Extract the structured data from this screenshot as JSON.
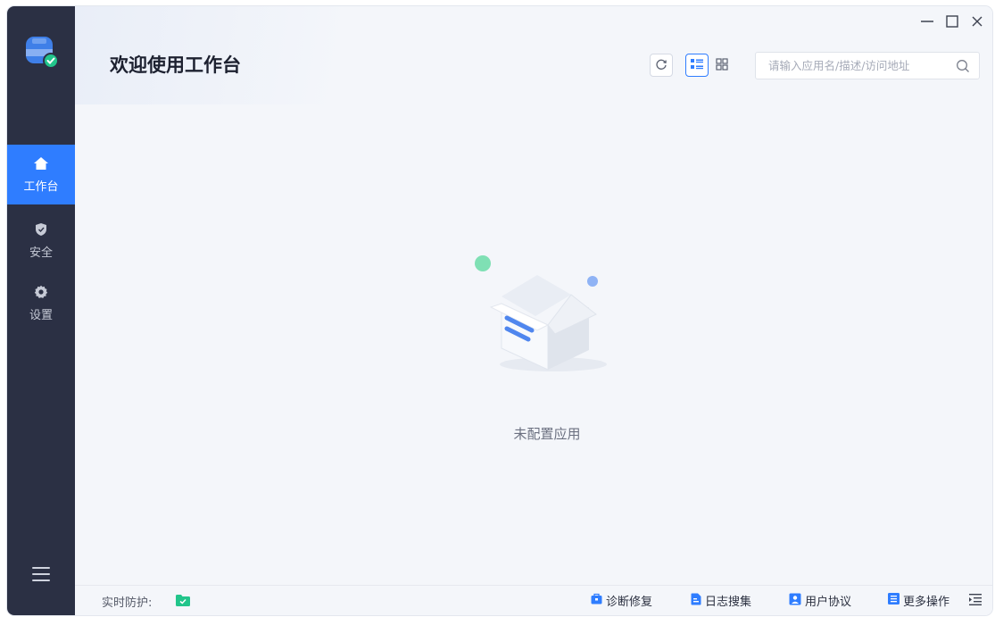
{
  "window": {
    "controls": {
      "minimize": "—",
      "maximize": "☐",
      "close": "X"
    }
  },
  "sidebar": {
    "items": [
      {
        "label": "工作台",
        "icon": "home-icon",
        "active": true
      },
      {
        "label": "安全",
        "icon": "shield-icon",
        "active": false
      },
      {
        "label": "设置",
        "icon": "gear-icon",
        "active": false
      }
    ],
    "menu_icon": "hamburger-menu-icon"
  },
  "header": {
    "title": "欢迎使用工作台",
    "search": {
      "placeholder": "请输入应用名/描述/访问地址",
      "value": ""
    }
  },
  "main": {
    "empty_text": "未配置应用"
  },
  "statusbar": {
    "protection_label": "实时防护:",
    "actions": [
      {
        "label": "诊断修复",
        "icon": "toolbox-icon"
      },
      {
        "label": "日志搜集",
        "icon": "document-icon"
      },
      {
        "label": "用户协议",
        "icon": "contract-icon"
      },
      {
        "label": "更多操作",
        "icon": "more-list-icon"
      }
    ]
  },
  "colors": {
    "sidebar_bg": "#2b3044",
    "accent": "#2f7dff",
    "success": "#22c58b",
    "background": "#f4f6fa"
  }
}
